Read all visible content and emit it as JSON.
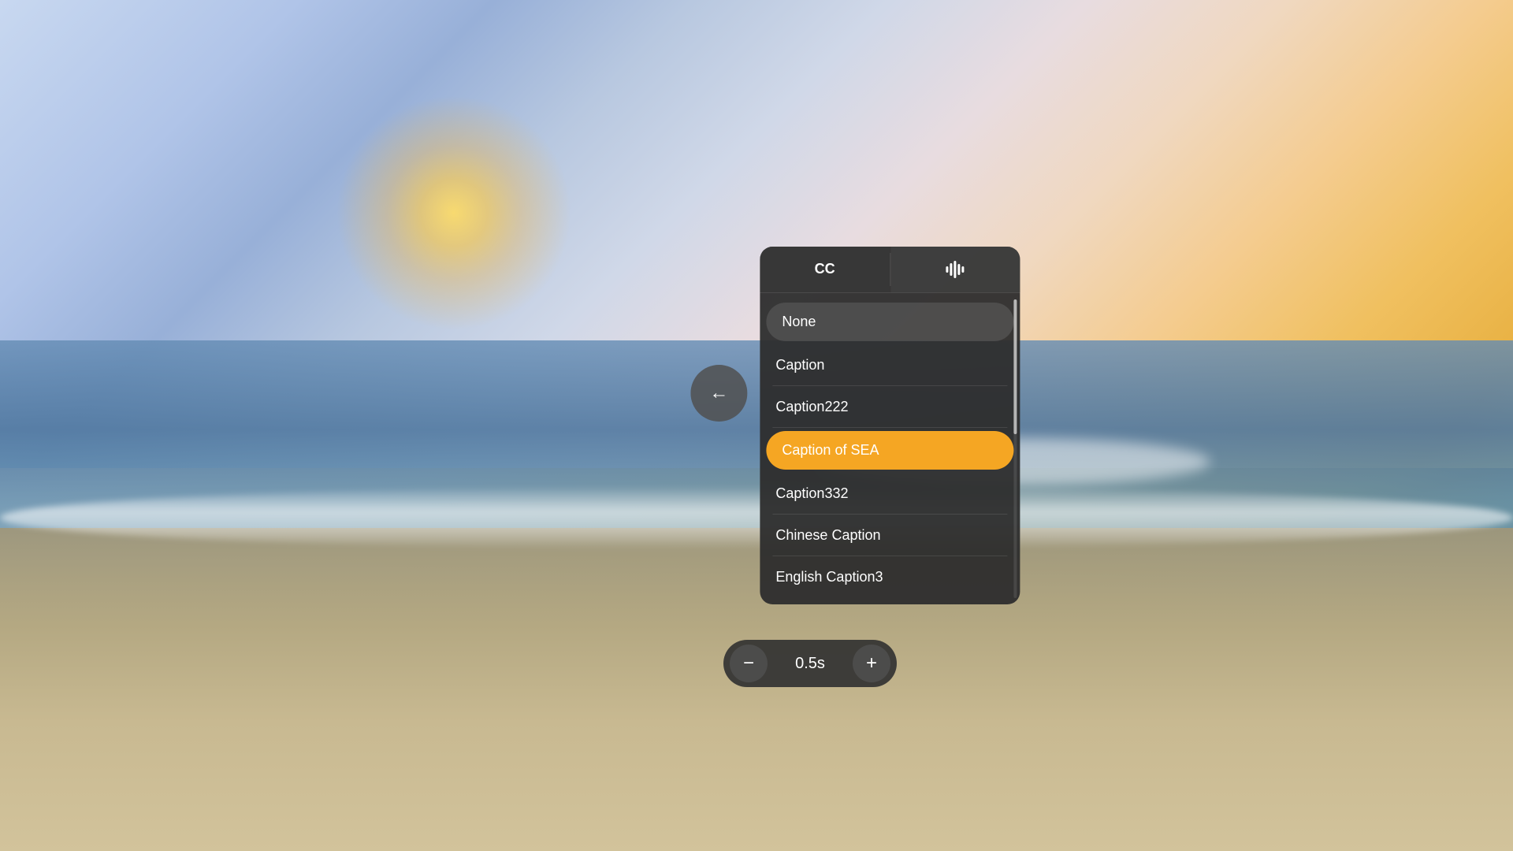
{
  "background": {
    "description": "Sunrise beach scene"
  },
  "backButton": {
    "label": "←",
    "ariaLabel": "Go back"
  },
  "panel": {
    "tabs": [
      {
        "id": "cc",
        "label": "CC",
        "active": true
      },
      {
        "id": "audio",
        "label": "|||",
        "active": false
      }
    ],
    "captionList": {
      "items": [
        {
          "id": "none",
          "label": "None",
          "selected": false,
          "type": "none"
        },
        {
          "id": "caption",
          "label": "Caption",
          "selected": false,
          "type": "normal"
        },
        {
          "id": "caption222",
          "label": "Caption222",
          "selected": false,
          "type": "normal"
        },
        {
          "id": "caption-of-sea",
          "label": "Caption of SEA",
          "selected": true,
          "type": "selected"
        },
        {
          "id": "caption332",
          "label": "Caption332",
          "selected": false,
          "type": "normal"
        },
        {
          "id": "chinese-caption",
          "label": "Chinese Caption",
          "selected": false,
          "type": "normal"
        },
        {
          "id": "english-caption3",
          "label": "English Caption3",
          "selected": false,
          "type": "normal"
        }
      ]
    }
  },
  "timeControl": {
    "decreaseLabel": "−",
    "increaseLabel": "+",
    "value": "0.5s"
  }
}
